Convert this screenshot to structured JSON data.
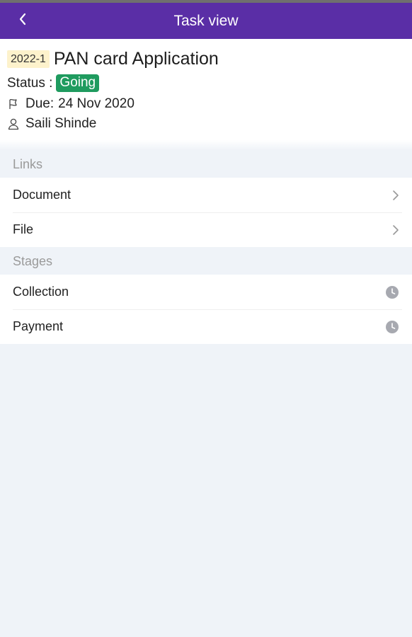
{
  "navbar": {
    "title": "Task view",
    "back_icon": "chevron-left-icon"
  },
  "task": {
    "id": "2022-1",
    "title": "PAN card Application",
    "status_label": "Status :",
    "status": "Going",
    "status_color": "#1f9b5f",
    "due_label": "Due:",
    "due_date": "24 Nov 2020",
    "assignee": "Saili Shinde"
  },
  "links": {
    "label": "Links",
    "items": [
      {
        "label": "Document",
        "icon": "chevron-right-icon"
      },
      {
        "label": "File",
        "icon": "chevron-right-icon"
      }
    ]
  },
  "stages": {
    "label": "Stages",
    "items": [
      {
        "label": "Collection",
        "icon": "clock-icon"
      },
      {
        "label": "Payment",
        "icon": "clock-icon"
      }
    ]
  },
  "colors": {
    "brand": "#5a2ea6",
    "id_badge_bg": "#fdf2cc"
  }
}
